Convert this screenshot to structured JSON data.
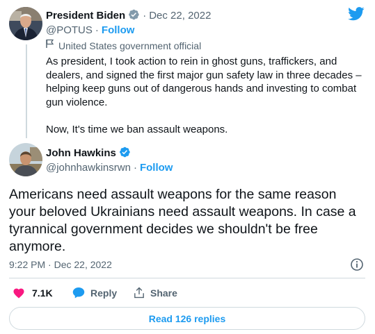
{
  "parent": {
    "name": "President Biden",
    "date": "Dec 22, 2022",
    "handle": "@POTUS",
    "follow_label": "Follow",
    "affiliation": "United States government official",
    "text_p1": "As president, I took action to rein in ghost guns, traffickers, and dealers, and signed the first major gun safety law in three decades – helping keep guns out of dangerous hands and investing to combat gun violence.",
    "text_p2": "Now, It's time we ban assault weapons."
  },
  "tweet": {
    "name": "John Hawkins",
    "handle": "@johnhawkinsrwn",
    "follow_label": "Follow",
    "text": "Americans need assault weapons for the same reason your beloved Ukrainians need assault weapons. In case a tyrannical government decides we shouldn't be free anymore.",
    "timestamp": "9:22 PM · Dec 22, 2022"
  },
  "actions": {
    "likes": "7.1K",
    "reply_label": "Reply",
    "share_label": "Share"
  },
  "read_replies_label": "Read 126 replies",
  "colors": {
    "accent": "#1d9bf0",
    "like": "#f91880",
    "muted": "#536471",
    "text": "#0f1419",
    "border": "#cfd9de"
  },
  "icons": [
    "twitter-logo-icon",
    "verified-badge-icon",
    "flag-icon",
    "info-icon",
    "heart-icon",
    "reply-bubble-icon",
    "share-icon"
  ]
}
